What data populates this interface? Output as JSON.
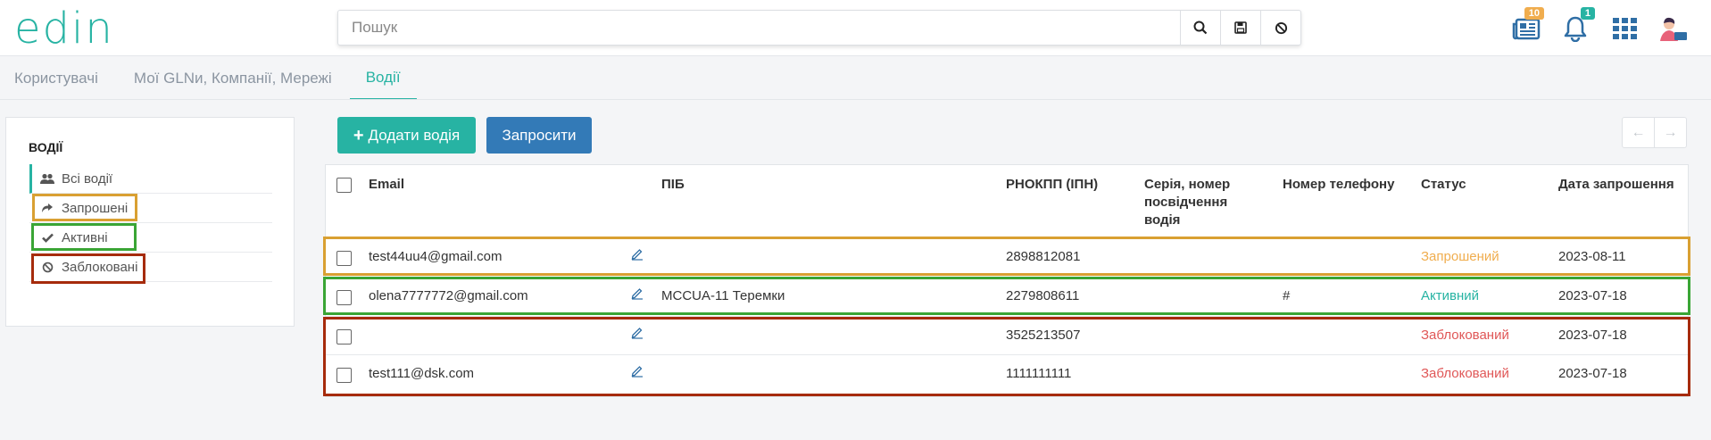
{
  "header": {
    "logo": "edin",
    "search_placeholder": "Пошук",
    "docs_badge": "10",
    "notif_badge": "1"
  },
  "tabs": [
    {
      "label": "Користувачі"
    },
    {
      "label": "Мої GLNи, Компанії, Мережі"
    },
    {
      "label": "Водії"
    }
  ],
  "sidebar": {
    "title": "ВОДІЇ",
    "items": [
      {
        "label": "Всі водії"
      },
      {
        "label": "Запрошені"
      },
      {
        "label": "Активні"
      },
      {
        "label": "Заблоковані"
      }
    ]
  },
  "toolbar": {
    "add_label": "Додати водія",
    "invite_label": "Запросити"
  },
  "table": {
    "headers": {
      "email": "Email",
      "pib": "ПІБ",
      "inn": "РНОКПП (ІПН)",
      "doc_line1": "Серія, номер",
      "doc_line2": "посвідчення",
      "doc_line3": "водія",
      "phone": "Номер телефону",
      "status": "Статус",
      "date": "Дата запрошення"
    },
    "rows": [
      {
        "email": "test44uu4@gmail.com",
        "pib": "",
        "inn": "2898812081",
        "doc": "",
        "phone": "",
        "status": "Запрошений",
        "date": "2023-08-11"
      },
      {
        "email": "olena7777772@gmail.com",
        "pib": "MCCUA-11 Теремки",
        "inn": "2279808611",
        "doc": "",
        "phone": "#",
        "status": "Активний",
        "date": "2023-07-18"
      },
      {
        "email": "",
        "pib": "",
        "inn": "3525213507",
        "doc": "",
        "phone": "",
        "status": "Заблокований",
        "date": "2023-07-18"
      },
      {
        "email": "test111@dsk.com",
        "pib": "",
        "inn": "1111111111",
        "doc": "",
        "phone": "",
        "status": "Заблокований",
        "date": "2023-07-18"
      }
    ]
  },
  "colors": {
    "accent": "#27b3a3",
    "invite_btn": "#337ab7",
    "status_invited": "#f0ad4e",
    "status_active": "#27b3a3",
    "status_blocked": "#e05757",
    "highlight_orange": "#d9a032",
    "highlight_green": "#3aa535",
    "highlight_red": "#a62b0c"
  }
}
